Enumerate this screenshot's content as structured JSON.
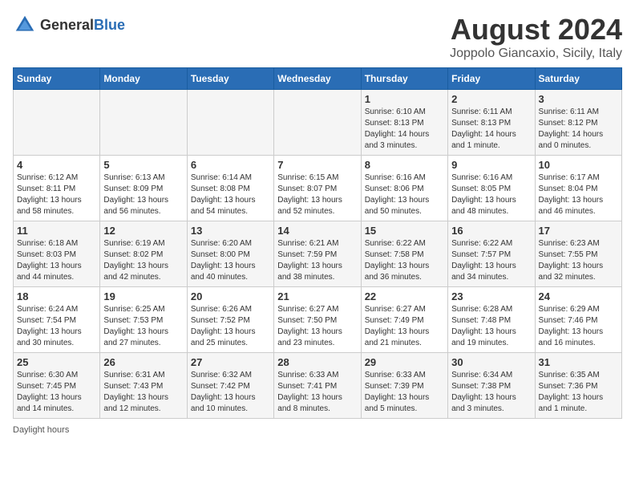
{
  "header": {
    "logo_general": "General",
    "logo_blue": "Blue",
    "title": "August 2024",
    "subtitle": "Joppolo Giancaxio, Sicily, Italy"
  },
  "calendar": {
    "days_of_week": [
      "Sunday",
      "Monday",
      "Tuesday",
      "Wednesday",
      "Thursday",
      "Friday",
      "Saturday"
    ],
    "weeks": [
      [
        {
          "day": "",
          "sunrise": "",
          "sunset": "",
          "daylight": ""
        },
        {
          "day": "",
          "sunrise": "",
          "sunset": "",
          "daylight": ""
        },
        {
          "day": "",
          "sunrise": "",
          "sunset": "",
          "daylight": ""
        },
        {
          "day": "",
          "sunrise": "",
          "sunset": "",
          "daylight": ""
        },
        {
          "day": "1",
          "sunrise": "Sunrise: 6:10 AM",
          "sunset": "Sunset: 8:13 PM",
          "daylight": "Daylight: 14 hours and 3 minutes."
        },
        {
          "day": "2",
          "sunrise": "Sunrise: 6:11 AM",
          "sunset": "Sunset: 8:13 PM",
          "daylight": "Daylight: 14 hours and 1 minute."
        },
        {
          "day": "3",
          "sunrise": "Sunrise: 6:11 AM",
          "sunset": "Sunset: 8:12 PM",
          "daylight": "Daylight: 14 hours and 0 minutes."
        }
      ],
      [
        {
          "day": "4",
          "sunrise": "Sunrise: 6:12 AM",
          "sunset": "Sunset: 8:11 PM",
          "daylight": "Daylight: 13 hours and 58 minutes."
        },
        {
          "day": "5",
          "sunrise": "Sunrise: 6:13 AM",
          "sunset": "Sunset: 8:09 PM",
          "daylight": "Daylight: 13 hours and 56 minutes."
        },
        {
          "day": "6",
          "sunrise": "Sunrise: 6:14 AM",
          "sunset": "Sunset: 8:08 PM",
          "daylight": "Daylight: 13 hours and 54 minutes."
        },
        {
          "day": "7",
          "sunrise": "Sunrise: 6:15 AM",
          "sunset": "Sunset: 8:07 PM",
          "daylight": "Daylight: 13 hours and 52 minutes."
        },
        {
          "day": "8",
          "sunrise": "Sunrise: 6:16 AM",
          "sunset": "Sunset: 8:06 PM",
          "daylight": "Daylight: 13 hours and 50 minutes."
        },
        {
          "day": "9",
          "sunrise": "Sunrise: 6:16 AM",
          "sunset": "Sunset: 8:05 PM",
          "daylight": "Daylight: 13 hours and 48 minutes."
        },
        {
          "day": "10",
          "sunrise": "Sunrise: 6:17 AM",
          "sunset": "Sunset: 8:04 PM",
          "daylight": "Daylight: 13 hours and 46 minutes."
        }
      ],
      [
        {
          "day": "11",
          "sunrise": "Sunrise: 6:18 AM",
          "sunset": "Sunset: 8:03 PM",
          "daylight": "Daylight: 13 hours and 44 minutes."
        },
        {
          "day": "12",
          "sunrise": "Sunrise: 6:19 AM",
          "sunset": "Sunset: 8:02 PM",
          "daylight": "Daylight: 13 hours and 42 minutes."
        },
        {
          "day": "13",
          "sunrise": "Sunrise: 6:20 AM",
          "sunset": "Sunset: 8:00 PM",
          "daylight": "Daylight: 13 hours and 40 minutes."
        },
        {
          "day": "14",
          "sunrise": "Sunrise: 6:21 AM",
          "sunset": "Sunset: 7:59 PM",
          "daylight": "Daylight: 13 hours and 38 minutes."
        },
        {
          "day": "15",
          "sunrise": "Sunrise: 6:22 AM",
          "sunset": "Sunset: 7:58 PM",
          "daylight": "Daylight: 13 hours and 36 minutes."
        },
        {
          "day": "16",
          "sunrise": "Sunrise: 6:22 AM",
          "sunset": "Sunset: 7:57 PM",
          "daylight": "Daylight: 13 hours and 34 minutes."
        },
        {
          "day": "17",
          "sunrise": "Sunrise: 6:23 AM",
          "sunset": "Sunset: 7:55 PM",
          "daylight": "Daylight: 13 hours and 32 minutes."
        }
      ],
      [
        {
          "day": "18",
          "sunrise": "Sunrise: 6:24 AM",
          "sunset": "Sunset: 7:54 PM",
          "daylight": "Daylight: 13 hours and 30 minutes."
        },
        {
          "day": "19",
          "sunrise": "Sunrise: 6:25 AM",
          "sunset": "Sunset: 7:53 PM",
          "daylight": "Daylight: 13 hours and 27 minutes."
        },
        {
          "day": "20",
          "sunrise": "Sunrise: 6:26 AM",
          "sunset": "Sunset: 7:52 PM",
          "daylight": "Daylight: 13 hours and 25 minutes."
        },
        {
          "day": "21",
          "sunrise": "Sunrise: 6:27 AM",
          "sunset": "Sunset: 7:50 PM",
          "daylight": "Daylight: 13 hours and 23 minutes."
        },
        {
          "day": "22",
          "sunrise": "Sunrise: 6:27 AM",
          "sunset": "Sunset: 7:49 PM",
          "daylight": "Daylight: 13 hours and 21 minutes."
        },
        {
          "day": "23",
          "sunrise": "Sunrise: 6:28 AM",
          "sunset": "Sunset: 7:48 PM",
          "daylight": "Daylight: 13 hours and 19 minutes."
        },
        {
          "day": "24",
          "sunrise": "Sunrise: 6:29 AM",
          "sunset": "Sunset: 7:46 PM",
          "daylight": "Daylight: 13 hours and 16 minutes."
        }
      ],
      [
        {
          "day": "25",
          "sunrise": "Sunrise: 6:30 AM",
          "sunset": "Sunset: 7:45 PM",
          "daylight": "Daylight: 13 hours and 14 minutes."
        },
        {
          "day": "26",
          "sunrise": "Sunrise: 6:31 AM",
          "sunset": "Sunset: 7:43 PM",
          "daylight": "Daylight: 13 hours and 12 minutes."
        },
        {
          "day": "27",
          "sunrise": "Sunrise: 6:32 AM",
          "sunset": "Sunset: 7:42 PM",
          "daylight": "Daylight: 13 hours and 10 minutes."
        },
        {
          "day": "28",
          "sunrise": "Sunrise: 6:33 AM",
          "sunset": "Sunset: 7:41 PM",
          "daylight": "Daylight: 13 hours and 8 minutes."
        },
        {
          "day": "29",
          "sunrise": "Sunrise: 6:33 AM",
          "sunset": "Sunset: 7:39 PM",
          "daylight": "Daylight: 13 hours and 5 minutes."
        },
        {
          "day": "30",
          "sunrise": "Sunrise: 6:34 AM",
          "sunset": "Sunset: 7:38 PM",
          "daylight": "Daylight: 13 hours and 3 minutes."
        },
        {
          "day": "31",
          "sunrise": "Sunrise: 6:35 AM",
          "sunset": "Sunset: 7:36 PM",
          "daylight": "Daylight: 13 hours and 1 minute."
        }
      ]
    ]
  },
  "legend": {
    "daylight_hours": "Daylight hours"
  }
}
